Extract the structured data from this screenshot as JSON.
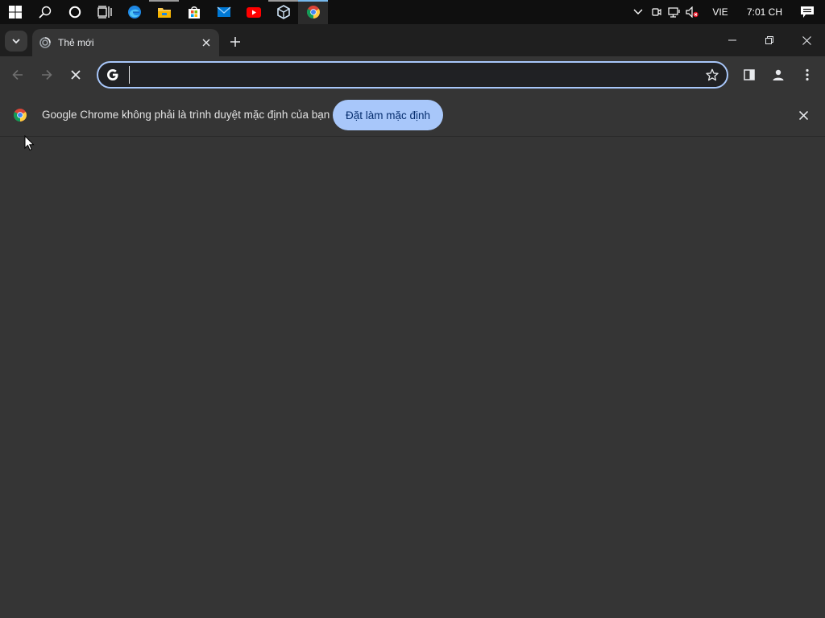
{
  "taskbar": {
    "apps": [
      {
        "name": "start-button-icon",
        "running": false
      },
      {
        "name": "search-icon",
        "running": false
      },
      {
        "name": "cortana-icon",
        "running": false
      },
      {
        "name": "task-view-icon",
        "running": false
      },
      {
        "name": "edge-icon",
        "running": false
      },
      {
        "name": "file-explorer-icon",
        "running": true
      },
      {
        "name": "microsoft-store-icon",
        "running": false
      },
      {
        "name": "mail-icon",
        "running": false
      },
      {
        "name": "youtube-icon",
        "running": false
      },
      {
        "name": "virtualbox-icon",
        "running": true
      },
      {
        "name": "chrome-icon",
        "running": true,
        "active": true
      }
    ],
    "tray": {
      "language": "VIE",
      "time": "7:01 CH"
    }
  },
  "browser": {
    "tab": {
      "title": "Thẻ mới"
    },
    "omnibox": {
      "value": "",
      "placeholder": ""
    },
    "infobar": {
      "message": "Google Chrome không phải là trình duyệt mặc định của bạn",
      "button_label": "Đặt làm mặc định"
    },
    "colors": {
      "accent": "#a8c7fa",
      "background": "#353535",
      "tabstrip": "#1f1f1f",
      "taskbar": "#0f0f0f"
    }
  }
}
